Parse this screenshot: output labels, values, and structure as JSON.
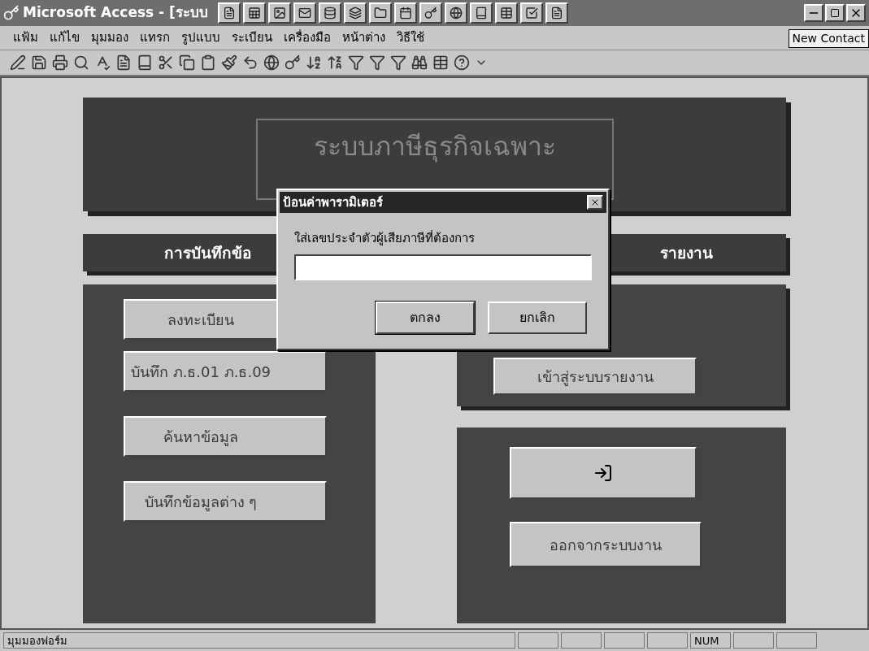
{
  "window": {
    "title": "Microsoft Access - [ระบบ"
  },
  "menu": [
    "แฟ้ม",
    "แก้ไข",
    "มุมมอง",
    "แทรก",
    "รูปแบบ",
    "ระเบียน",
    "เครื่องมือ",
    "หน้าต่าง",
    "วิธีใช้"
  ],
  "tooltip": "New Contact",
  "form": {
    "title": "ระบบภาษีธุรกิจเฉพาะ",
    "sections": [
      "การบันทึกข้อ",
      "รายงาน"
    ],
    "left_buttons": [
      "ลงทะเบียน",
      "บันทึก ภ.ธ.01 ภ.ธ.09",
      "ค้นหาข้อมูล",
      "บันทึกข้อมูลต่าง ๆ"
    ],
    "report_button": "เข้าสู่ระบบรายงาน",
    "exit_button": "ออกจากระบบงาน"
  },
  "dialog": {
    "title": "ป้อนค่าพารามิเตอร์",
    "prompt": "ใส่เลขประจำตัวผู้เสียภาษีที่ต้องการ",
    "buttons": [
      "ตกลง",
      "ยกเลิก"
    ]
  },
  "status_bar": {
    "text": "มุมมองฟอร์ม",
    "indicator": "NUM"
  }
}
